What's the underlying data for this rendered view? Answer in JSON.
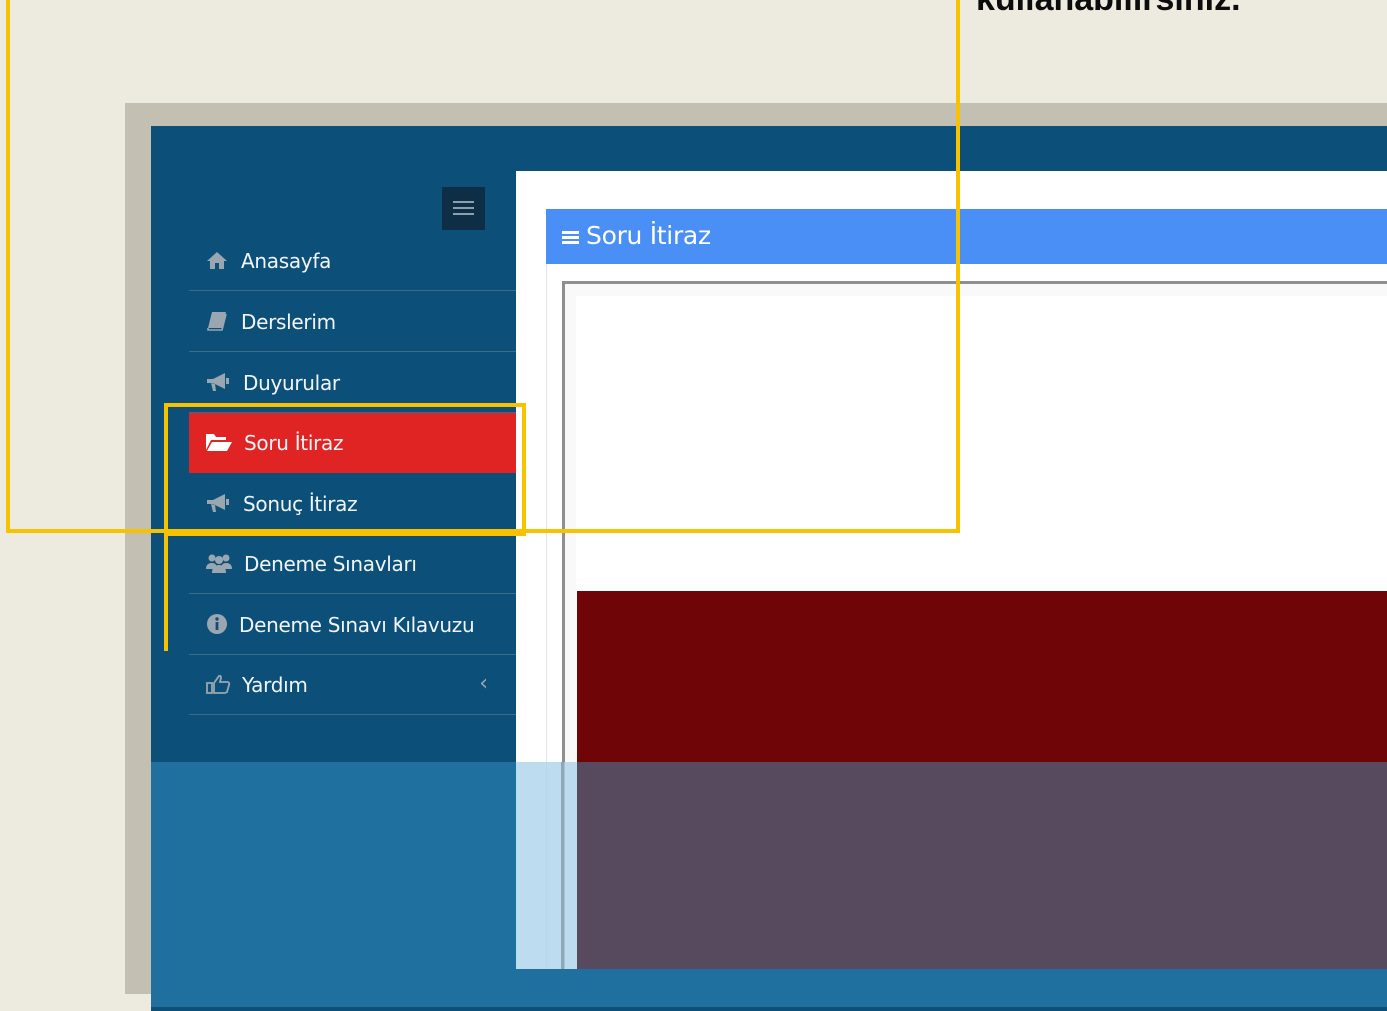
{
  "caption": {
    "text": "kullanabilirsiniz."
  },
  "sidebar": {
    "toggle_icon": "hamburger-icon",
    "items": [
      {
        "label": "Anasayfa",
        "icon": "home-icon"
      },
      {
        "label": "Derslerim",
        "icon": "book-icon"
      },
      {
        "label": "Duyurular",
        "icon": "bullhorn-icon"
      },
      {
        "label": "Soru İtiraz",
        "icon": "folder-open-icon",
        "active": true
      },
      {
        "label": "Sonuç İtiraz",
        "icon": "bullhorn-icon"
      },
      {
        "label": "Deneme Sınavları",
        "icon": "users-icon"
      },
      {
        "label": "Deneme Sınavı Kılavuzu",
        "icon": "info-circle-icon"
      },
      {
        "label": "Yardım",
        "icon": "hand-pointer-icon",
        "submenu_indicator": "chevron-left-icon"
      }
    ]
  },
  "panel": {
    "title": "Soru İtiraz",
    "icon": "hamburger-icon"
  },
  "colors": {
    "sidebar_bg": "#0c5079",
    "active_item": "#e02424",
    "panel_header": "#4a8ff5",
    "highlight": "#f7c300",
    "page_bg": "#edeadf"
  }
}
